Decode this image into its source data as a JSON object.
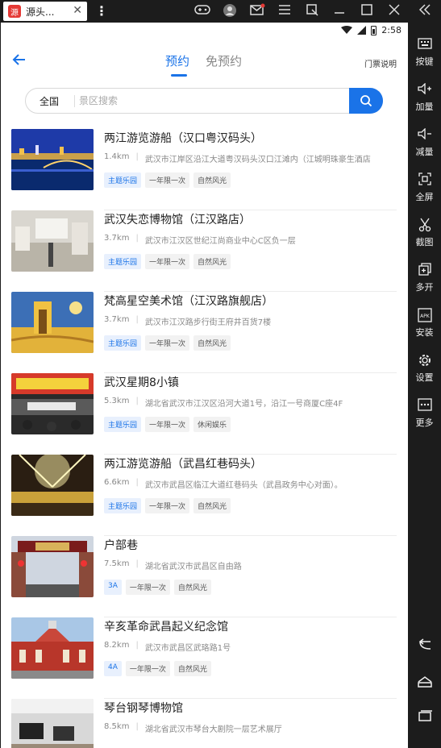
{
  "window": {
    "tab_title": "源头...",
    "tab_logo": "源",
    "tab_close": "✕",
    "menu_icon": "⋮",
    "toolbar_icons": [
      "gamepad-icon",
      "avatar-icon",
      "mail-icon",
      "menu-icon",
      "pin-icon",
      "minimize-icon",
      "maximize-icon",
      "close-icon",
      "collapse-icon"
    ]
  },
  "status": {
    "time": "2:58"
  },
  "header": {
    "tab_reserve": "预约",
    "tab_free": "免预约",
    "ticket_info": "门票说明"
  },
  "search": {
    "region": "全国",
    "placeholder": "景区搜索"
  },
  "attractions": [
    {
      "name": "两江游览游船（汉口粤汉码头）",
      "distance": "1.4km",
      "address": "武汉市江岸区沿江大道粤汉码头汉口江滩内（江城明珠豪生酒店",
      "tags": [
        {
          "label": "主题乐园",
          "highlight": true
        },
        {
          "label": "一年限一次",
          "highlight": false
        },
        {
          "label": "自然风光",
          "highlight": false
        }
      ]
    },
    {
      "name": "武汉失恋博物馆（江汉路店）",
      "distance": "3.7km",
      "address": "武汉市江汉区世纪江尚商业中心C区负一层",
      "tags": [
        {
          "label": "主题乐园",
          "highlight": true
        },
        {
          "label": "一年限一次",
          "highlight": false
        },
        {
          "label": "自然风光",
          "highlight": false
        }
      ]
    },
    {
      "name": "梵高星空美术馆（江汉路旗舰店）",
      "distance": "3.7km",
      "address": "武汉市江汉路步行街王府井百货7楼",
      "tags": [
        {
          "label": "主题乐园",
          "highlight": true
        },
        {
          "label": "一年限一次",
          "highlight": false
        },
        {
          "label": "自然风光",
          "highlight": false
        }
      ]
    },
    {
      "name": "武汉星期8小镇",
      "distance": "5.3km",
      "address": "湖北省武汉市江汉区沿河大道1号，沿江一号商厦C座4F",
      "tags": [
        {
          "label": "主题乐园",
          "highlight": true
        },
        {
          "label": "一年限一次",
          "highlight": false
        },
        {
          "label": "休闲娱乐",
          "highlight": false
        }
      ]
    },
    {
      "name": "两江游览游船（武昌红巷码头）",
      "distance": "6.6km",
      "address": "武汉市武昌区临江大道红巷码头（武昌政务中心对面）。",
      "tags": [
        {
          "label": "主题乐园",
          "highlight": true
        },
        {
          "label": "一年限一次",
          "highlight": false
        },
        {
          "label": "自然风光",
          "highlight": false
        }
      ]
    },
    {
      "name": "户部巷",
      "distance": "7.5km",
      "address": "湖北省武汉市武昌区自由路",
      "tags": [
        {
          "label": "3A",
          "highlight": true
        },
        {
          "label": "一年限一次",
          "highlight": false
        },
        {
          "label": "自然风光",
          "highlight": false
        }
      ]
    },
    {
      "name": "辛亥革命武昌起义纪念馆",
      "distance": "8.2km",
      "address": "武汉市武昌区武珞路1号",
      "tags": [
        {
          "label": "4A",
          "highlight": true
        },
        {
          "label": "一年限一次",
          "highlight": false
        },
        {
          "label": "自然风光",
          "highlight": false
        }
      ]
    },
    {
      "name": "琴台钢琴博物馆",
      "distance": "8.5km",
      "address": "湖北省武汉市琴台大剧院一层艺术展厅",
      "tags": []
    }
  ],
  "sidebar": [
    {
      "label": "按键",
      "icon": "keyboard-icon"
    },
    {
      "label": "加量",
      "icon": "volume-up-icon"
    },
    {
      "label": "减量",
      "icon": "volume-down-icon"
    },
    {
      "label": "全屏",
      "icon": "fullscreen-icon"
    },
    {
      "label": "截图",
      "icon": "scissors-icon"
    },
    {
      "label": "多开",
      "icon": "multi-instance-icon"
    },
    {
      "label": "安装",
      "icon": "apk-icon"
    },
    {
      "label": "设置",
      "icon": "gear-icon"
    },
    {
      "label": "更多",
      "icon": "more-icon"
    }
  ],
  "sidebar_nav": [
    "back-nav-icon",
    "home-nav-icon",
    "recents-nav-icon"
  ]
}
